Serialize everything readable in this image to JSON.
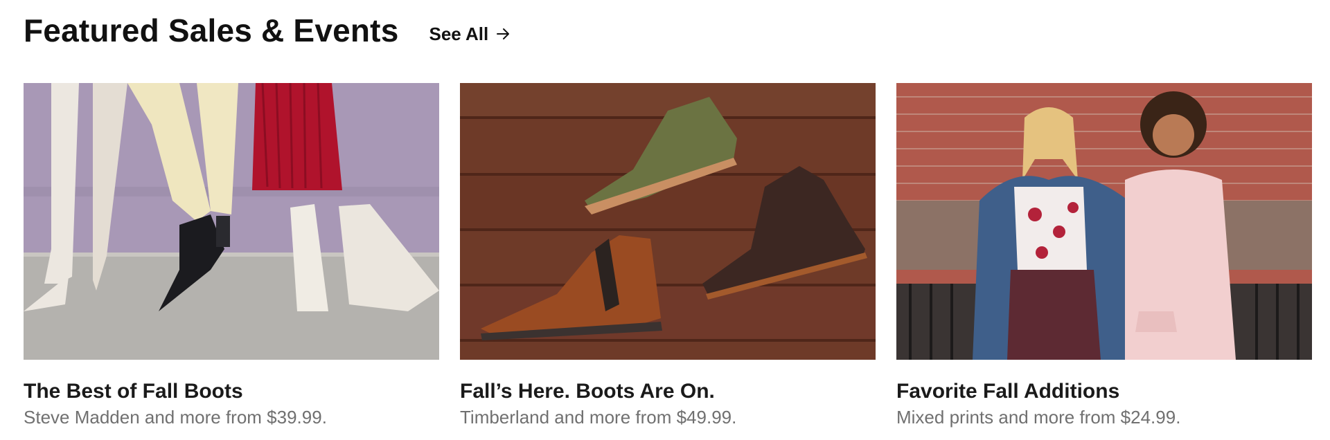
{
  "section": {
    "title": "Featured Sales & Events",
    "see_all_label": "See All",
    "see_all_icon": "arrow-right-icon"
  },
  "cards": [
    {
      "title": "The Best of Fall Boots",
      "subtitle": "Steve Madden and more from $39.99.",
      "image": "fall-boots-legs-photo"
    },
    {
      "title": "Fall’s Here. Boots Are On.",
      "subtitle": "Timberland and more from $49.99.",
      "image": "boots-on-wood-floor-photo"
    },
    {
      "title": "Favorite Fall Additions",
      "subtitle": "Mixed prints and more from $24.99.",
      "image": "two-women-brick-wall-photo"
    }
  ],
  "colors": {
    "text_primary": "#111111",
    "text_secondary": "#707070",
    "background": "#ffffff"
  }
}
